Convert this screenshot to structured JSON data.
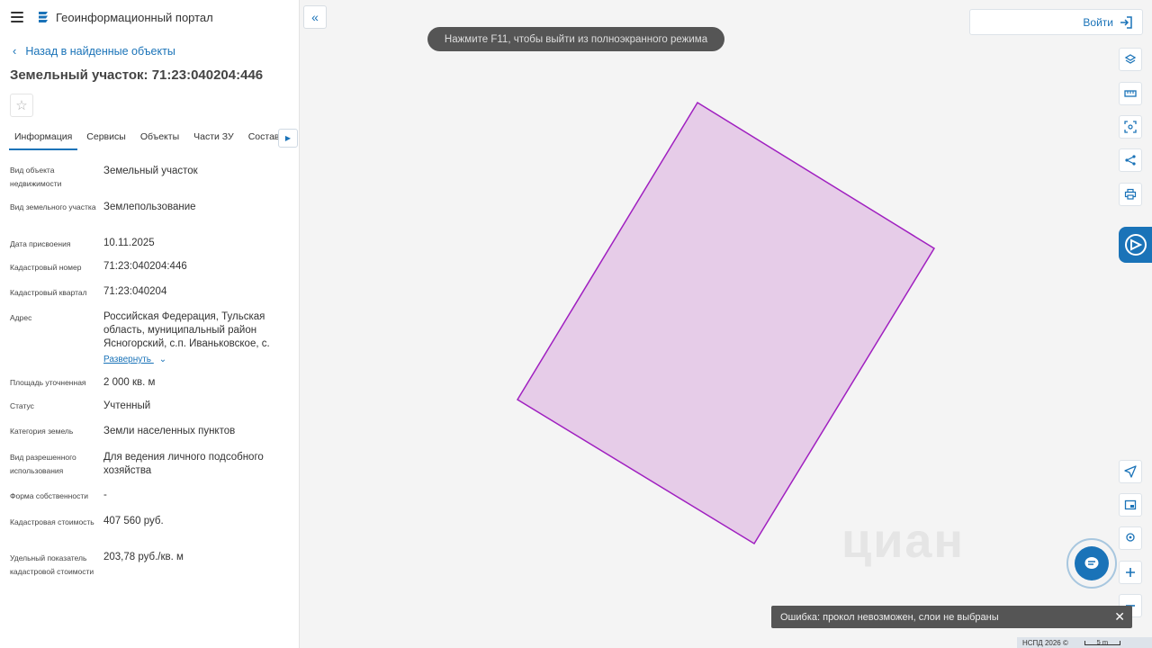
{
  "header": {
    "app_title": "Геоинформационный портал"
  },
  "nav": {
    "back_label": "Назад в найденные объекты"
  },
  "page": {
    "title": "Земельный участок: 71:23:040204:446"
  },
  "tabs": [
    {
      "label": "Информация",
      "active": true
    },
    {
      "label": "Сервисы"
    },
    {
      "label": "Объекты"
    },
    {
      "label": "Части ЗУ"
    },
    {
      "label": "Состав"
    }
  ],
  "properties": [
    {
      "label": "Вид объекта недвижимости",
      "value": "Земельный участок"
    },
    {
      "label": "Вид земельного участка",
      "value": "Землепользование"
    },
    {
      "label": "Дата присвоения",
      "value": "10.11.2025"
    },
    {
      "label": "Кадастровый номер",
      "value": "71:23:040204:446"
    },
    {
      "label": "Кадастровый квартал",
      "value": "71:23:040204"
    },
    {
      "label": "Адрес",
      "value": "Российская Федерация, Тульская область, муниципальный район Ясногорский, с.п. Иваньковское, с.",
      "expand_label": "Развернуть"
    },
    {
      "label": "Площадь уточненная",
      "value": "2 000 кв. м"
    },
    {
      "label": "Статус",
      "value": "Учтенный"
    },
    {
      "label": "Категория земель",
      "value": "Земли населенных пунктов"
    },
    {
      "label": "Вид разрешенного использования",
      "value": "Для ведения личного подсобного хозяйства"
    },
    {
      "label": "Форма собственности",
      "value": "-"
    },
    {
      "label": "Кадастровая стоимость",
      "value": "407 560 руб."
    },
    {
      "label": "Удельный показатель кадастровой стоимости",
      "value": "203,78 руб./кв. м"
    }
  ],
  "map": {
    "fullscreen_hint": "Нажмите F11, чтобы выйти из полноэкранного режима",
    "login_label": "Войти",
    "watermark": "циан",
    "parcel_fill": "#e6cce8",
    "parcel_stroke": "#a020c0",
    "toast_text": "Ошибка: прокол невозможен, слои не выбраны",
    "footer_copyright": "НСПД 2026 ©",
    "scale_label": "5 m"
  },
  "colors": {
    "accent": "#1a73b8"
  }
}
